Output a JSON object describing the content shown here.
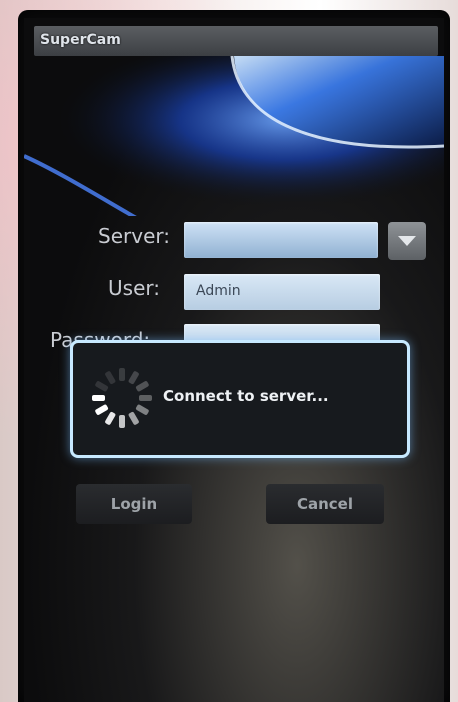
{
  "app": {
    "title": "SuperCam"
  },
  "form": {
    "server_label": "Server:",
    "server_value": "",
    "user_label": "User:",
    "user_value": "Admin",
    "password_label": "Password:",
    "password_value": ""
  },
  "dialog": {
    "message": "Connect to server..."
  },
  "buttons": {
    "login": "Login",
    "cancel": "Cancel"
  },
  "colors": {
    "dialog_border": "#c7e9ff",
    "field_fill": "#c8dcef",
    "title_bar": "#4a4d51"
  },
  "icons": {
    "dropdown": "chevron-down-icon",
    "spinner": "spinner-icon"
  }
}
